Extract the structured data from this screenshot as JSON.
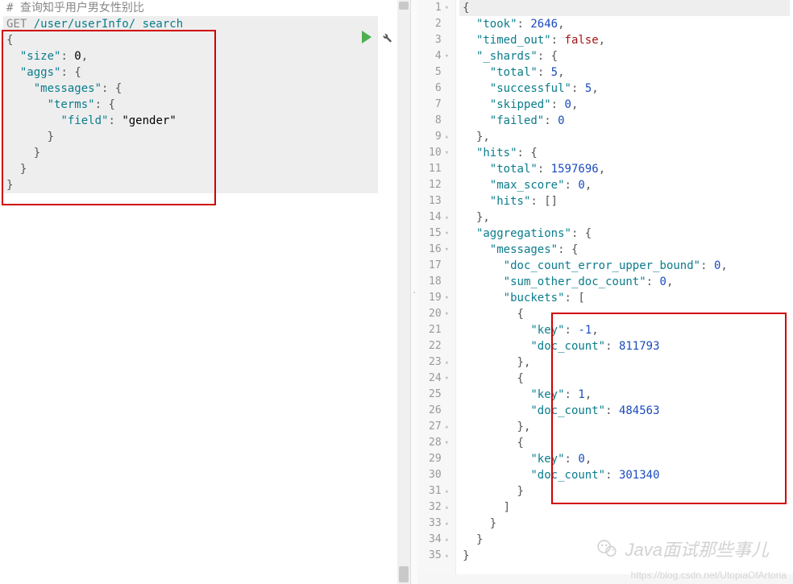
{
  "left": {
    "comment": "# 查询知乎用户男女性别比",
    "request_verb": "GET",
    "request_path": "/user/userInfo/_search",
    "body_lines": [
      "{",
      "  \"size\": 0,",
      "  \"aggs\": {",
      "    \"messages\": {",
      "      \"terms\": {",
      "        \"field\": \"gender\"",
      "      }",
      "    }",
      "  }",
      "}"
    ]
  },
  "right": {
    "lines": [
      {
        "n": 1,
        "fold": "▾",
        "t": [
          {
            "c": "punc",
            "v": "{"
          }
        ]
      },
      {
        "n": 2,
        "t": [
          {
            "c": "ind",
            "v": "  "
          },
          {
            "c": "key",
            "v": "\"took\""
          },
          {
            "c": "punc",
            "v": ": "
          },
          {
            "c": "num",
            "v": "2646"
          },
          {
            "c": "punc",
            "v": ","
          }
        ]
      },
      {
        "n": 3,
        "t": [
          {
            "c": "ind",
            "v": "  "
          },
          {
            "c": "key",
            "v": "\"timed_out\""
          },
          {
            "c": "punc",
            "v": ": "
          },
          {
            "c": "bool",
            "v": "false"
          },
          {
            "c": "punc",
            "v": ","
          }
        ]
      },
      {
        "n": 4,
        "fold": "▾",
        "t": [
          {
            "c": "ind",
            "v": "  "
          },
          {
            "c": "key",
            "v": "\"_shards\""
          },
          {
            "c": "punc",
            "v": ": {"
          }
        ]
      },
      {
        "n": 5,
        "t": [
          {
            "c": "ind",
            "v": "    "
          },
          {
            "c": "key",
            "v": "\"total\""
          },
          {
            "c": "punc",
            "v": ": "
          },
          {
            "c": "num",
            "v": "5"
          },
          {
            "c": "punc",
            "v": ","
          }
        ]
      },
      {
        "n": 6,
        "t": [
          {
            "c": "ind",
            "v": "    "
          },
          {
            "c": "key",
            "v": "\"successful\""
          },
          {
            "c": "punc",
            "v": ": "
          },
          {
            "c": "num",
            "v": "5"
          },
          {
            "c": "punc",
            "v": ","
          }
        ]
      },
      {
        "n": 7,
        "t": [
          {
            "c": "ind",
            "v": "    "
          },
          {
            "c": "key",
            "v": "\"skipped\""
          },
          {
            "c": "punc",
            "v": ": "
          },
          {
            "c": "num",
            "v": "0"
          },
          {
            "c": "punc",
            "v": ","
          }
        ]
      },
      {
        "n": 8,
        "t": [
          {
            "c": "ind",
            "v": "    "
          },
          {
            "c": "key",
            "v": "\"failed\""
          },
          {
            "c": "punc",
            "v": ": "
          },
          {
            "c": "num",
            "v": "0"
          }
        ]
      },
      {
        "n": 9,
        "fold": "▴",
        "t": [
          {
            "c": "ind",
            "v": "  "
          },
          {
            "c": "punc",
            "v": "},"
          }
        ]
      },
      {
        "n": 10,
        "fold": "▾",
        "t": [
          {
            "c": "ind",
            "v": "  "
          },
          {
            "c": "key",
            "v": "\"hits\""
          },
          {
            "c": "punc",
            "v": ": {"
          }
        ]
      },
      {
        "n": 11,
        "t": [
          {
            "c": "ind",
            "v": "    "
          },
          {
            "c": "key",
            "v": "\"total\""
          },
          {
            "c": "punc",
            "v": ": "
          },
          {
            "c": "num",
            "v": "1597696"
          },
          {
            "c": "punc",
            "v": ","
          }
        ]
      },
      {
        "n": 12,
        "t": [
          {
            "c": "ind",
            "v": "    "
          },
          {
            "c": "key",
            "v": "\"max_score\""
          },
          {
            "c": "punc",
            "v": ": "
          },
          {
            "c": "num",
            "v": "0"
          },
          {
            "c": "punc",
            "v": ","
          }
        ]
      },
      {
        "n": 13,
        "t": [
          {
            "c": "ind",
            "v": "    "
          },
          {
            "c": "key",
            "v": "\"hits\""
          },
          {
            "c": "punc",
            "v": ": []"
          }
        ]
      },
      {
        "n": 14,
        "fold": "▴",
        "t": [
          {
            "c": "ind",
            "v": "  "
          },
          {
            "c": "punc",
            "v": "},"
          }
        ]
      },
      {
        "n": 15,
        "fold": "▾",
        "t": [
          {
            "c": "ind",
            "v": "  "
          },
          {
            "c": "key",
            "v": "\"aggregations\""
          },
          {
            "c": "punc",
            "v": ": {"
          }
        ]
      },
      {
        "n": 16,
        "fold": "▾",
        "t": [
          {
            "c": "ind",
            "v": "    "
          },
          {
            "c": "key",
            "v": "\"messages\""
          },
          {
            "c": "punc",
            "v": ": {"
          }
        ]
      },
      {
        "n": 17,
        "t": [
          {
            "c": "ind",
            "v": "      "
          },
          {
            "c": "key",
            "v": "\"doc_count_error_upper_bound\""
          },
          {
            "c": "punc",
            "v": ": "
          },
          {
            "c": "num",
            "v": "0"
          },
          {
            "c": "punc",
            "v": ","
          }
        ]
      },
      {
        "n": 18,
        "t": [
          {
            "c": "ind",
            "v": "      "
          },
          {
            "c": "key",
            "v": "\"sum_other_doc_count\""
          },
          {
            "c": "punc",
            "v": ": "
          },
          {
            "c": "num",
            "v": "0"
          },
          {
            "c": "punc",
            "v": ","
          }
        ]
      },
      {
        "n": 19,
        "fold": "▾",
        "t": [
          {
            "c": "ind",
            "v": "      "
          },
          {
            "c": "key",
            "v": "\"buckets\""
          },
          {
            "c": "punc",
            "v": ": ["
          }
        ]
      },
      {
        "n": 20,
        "fold": "▾",
        "t": [
          {
            "c": "ind",
            "v": "        "
          },
          {
            "c": "punc",
            "v": "{"
          }
        ]
      },
      {
        "n": 21,
        "t": [
          {
            "c": "ind",
            "v": "          "
          },
          {
            "c": "key",
            "v": "\"key\""
          },
          {
            "c": "punc",
            "v": ": "
          },
          {
            "c": "num",
            "v": "-1"
          },
          {
            "c": "punc",
            "v": ","
          }
        ]
      },
      {
        "n": 22,
        "t": [
          {
            "c": "ind",
            "v": "          "
          },
          {
            "c": "key",
            "v": "\"doc_count\""
          },
          {
            "c": "punc",
            "v": ": "
          },
          {
            "c": "num",
            "v": "811793"
          }
        ]
      },
      {
        "n": 23,
        "fold": "▴",
        "t": [
          {
            "c": "ind",
            "v": "        "
          },
          {
            "c": "punc",
            "v": "},"
          }
        ]
      },
      {
        "n": 24,
        "fold": "▾",
        "t": [
          {
            "c": "ind",
            "v": "        "
          },
          {
            "c": "punc",
            "v": "{"
          }
        ]
      },
      {
        "n": 25,
        "t": [
          {
            "c": "ind",
            "v": "          "
          },
          {
            "c": "key",
            "v": "\"key\""
          },
          {
            "c": "punc",
            "v": ": "
          },
          {
            "c": "num",
            "v": "1"
          },
          {
            "c": "punc",
            "v": ","
          }
        ]
      },
      {
        "n": 26,
        "t": [
          {
            "c": "ind",
            "v": "          "
          },
          {
            "c": "key",
            "v": "\"doc_count\""
          },
          {
            "c": "punc",
            "v": ": "
          },
          {
            "c": "num",
            "v": "484563"
          }
        ]
      },
      {
        "n": 27,
        "fold": "▴",
        "t": [
          {
            "c": "ind",
            "v": "        "
          },
          {
            "c": "punc",
            "v": "},"
          }
        ]
      },
      {
        "n": 28,
        "fold": "▾",
        "t": [
          {
            "c": "ind",
            "v": "        "
          },
          {
            "c": "punc",
            "v": "{"
          }
        ]
      },
      {
        "n": 29,
        "t": [
          {
            "c": "ind",
            "v": "          "
          },
          {
            "c": "key",
            "v": "\"key\""
          },
          {
            "c": "punc",
            "v": ": "
          },
          {
            "c": "num",
            "v": "0"
          },
          {
            "c": "punc",
            "v": ","
          }
        ]
      },
      {
        "n": 30,
        "t": [
          {
            "c": "ind",
            "v": "          "
          },
          {
            "c": "key",
            "v": "\"doc_count\""
          },
          {
            "c": "punc",
            "v": ": "
          },
          {
            "c": "num",
            "v": "301340"
          }
        ]
      },
      {
        "n": 31,
        "fold": "▴",
        "t": [
          {
            "c": "ind",
            "v": "        "
          },
          {
            "c": "punc",
            "v": "}"
          }
        ]
      },
      {
        "n": 32,
        "fold": "▴",
        "t": [
          {
            "c": "ind",
            "v": "      "
          },
          {
            "c": "punc",
            "v": "]"
          }
        ]
      },
      {
        "n": 33,
        "fold": "▴",
        "t": [
          {
            "c": "ind",
            "v": "    "
          },
          {
            "c": "punc",
            "v": "}"
          }
        ]
      },
      {
        "n": 34,
        "fold": "▴",
        "t": [
          {
            "c": "ind",
            "v": "  "
          },
          {
            "c": "punc",
            "v": "}"
          }
        ]
      },
      {
        "n": 35,
        "fold": "▴",
        "t": [
          {
            "c": "punc",
            "v": "}"
          }
        ]
      }
    ]
  },
  "watermark": "Java面试那些事儿",
  "url_watermark": "https://blog.csdn.net/UtopiaOfArtoria"
}
